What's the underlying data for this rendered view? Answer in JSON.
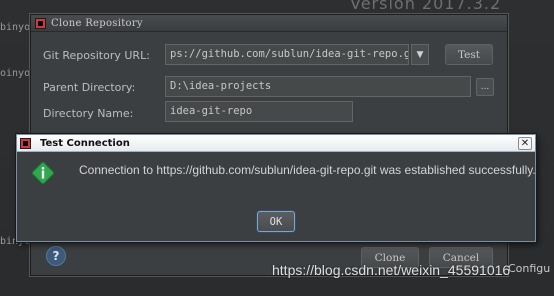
{
  "background": {
    "version_text": "Version 2017.3.2",
    "left_fragments": [
      "binyov",
      "oinyov",
      "binyov"
    ],
    "right_fragment": "Configu"
  },
  "clone_dialog": {
    "title": "Clone Repository",
    "git_url_label": "Git Repository URL:",
    "git_url_value": "ps://github.com/sublun/idea-git-repo.git",
    "test_button": "Test",
    "parent_dir_label": "Parent Directory:",
    "parent_dir_value": "D:\\idea-projects",
    "browse_button": "...",
    "dir_name_label": "Directory Name:",
    "dir_name_value": "idea-git-repo",
    "help_button": "?",
    "clone_button": "Clone",
    "cancel_button": "Cancel"
  },
  "test_dialog": {
    "title": "Test Connection",
    "message": "Connection to https://github.com/sublun/idea-git-repo.git was established successfully.",
    "ok_button": "OK",
    "close_glyph": "✕"
  },
  "watermark": "https://blog.csdn.net/weixin_45591016",
  "colors": {
    "success_icon": "#2fa84f",
    "dialog_bg": "#3c3f41",
    "titlebar_light": "#e6eaf0"
  }
}
